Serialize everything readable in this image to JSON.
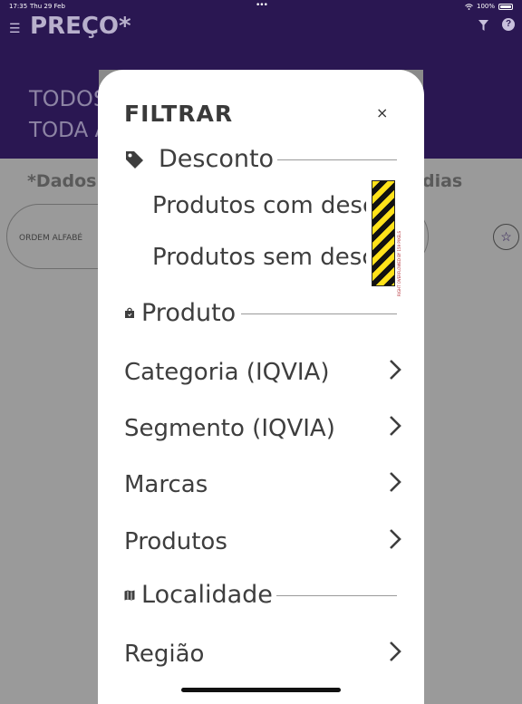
{
  "status_bar": {
    "time": "17:35",
    "date": "Thu 29 Feb",
    "battery": "100%"
  },
  "app_bar": {
    "title": "PREÇO*"
  },
  "background": {
    "banner_line1": "TODOS",
    "banner_line2": "TODA A",
    "note_left": "*Dados",
    "note_right": "dias",
    "sort_label": "ORDEM ALFABÉ"
  },
  "filter_sheet": {
    "title": "FILTRAR",
    "close_symbol": "×",
    "sections": {
      "desconto": {
        "label": "Desconto",
        "options": [
          "Produtos com desconto",
          "Produtos sem desconto"
        ]
      },
      "produto": {
        "label": "Produto",
        "items": [
          "Categoria (IQVIA)",
          "Segmento (IQVIA)",
          "Marcas",
          "Produtos"
        ]
      },
      "localidade": {
        "label": "Localidade",
        "items": [
          "Região"
        ]
      }
    },
    "overflow_text": "RIGHT OVERFLOWED BY 159 PIXELS"
  },
  "colors": {
    "app_bar": "#2a1752",
    "overlay": "#9a9a9a",
    "sheet": "#ffffff",
    "text": "#3e3e3e"
  },
  "icons": [
    "menu-icon",
    "filter-icon",
    "help-icon",
    "star-icon",
    "tag-icon",
    "bag-icon",
    "map-icon",
    "chevron-right-icon",
    "close-icon"
  ]
}
